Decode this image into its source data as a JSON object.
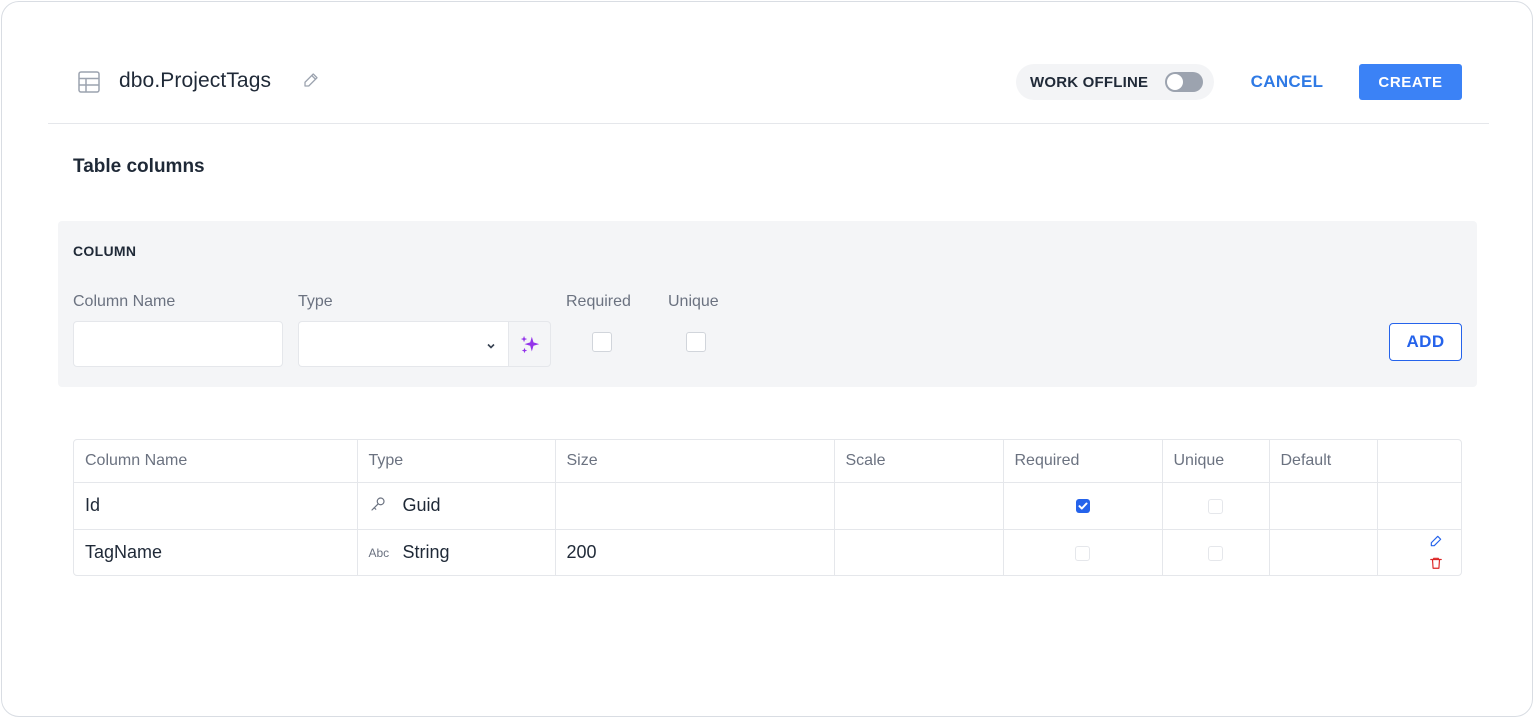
{
  "header": {
    "table_name": "dbo.ProjectTags",
    "work_offline_label": "WORK OFFLINE",
    "work_offline_enabled": false,
    "cancel_label": "CANCEL",
    "create_label": "CREATE"
  },
  "section_title": "Table columns",
  "column_form": {
    "panel_title": "COLUMN",
    "name_label": "Column Name",
    "name_value": "",
    "type_label": "Type",
    "type_value": "",
    "required_label": "Required",
    "required_checked": false,
    "unique_label": "Unique",
    "unique_checked": false,
    "add_label": "ADD"
  },
  "columns_table": {
    "headers": [
      "Column Name",
      "Type",
      "Size",
      "Scale",
      "Required",
      "Unique",
      "Default",
      ""
    ],
    "rows": [
      {
        "name": "Id",
        "type_icon": "key-icon",
        "type": "Guid",
        "size": "",
        "scale": "",
        "required": true,
        "unique": false,
        "default": "",
        "actions": []
      },
      {
        "name": "TagName",
        "type_icon": "abc-icon",
        "type_icon_text": "Abc",
        "type": "String",
        "size": "200",
        "scale": "",
        "required": false,
        "unique": false,
        "default": "",
        "actions": [
          "edit-icon",
          "delete-icon"
        ]
      }
    ]
  },
  "colors": {
    "accent": "#3b82f6",
    "link": "#2f7ae5",
    "ai_icon": "#9333ea",
    "delete": "#dc2626"
  }
}
